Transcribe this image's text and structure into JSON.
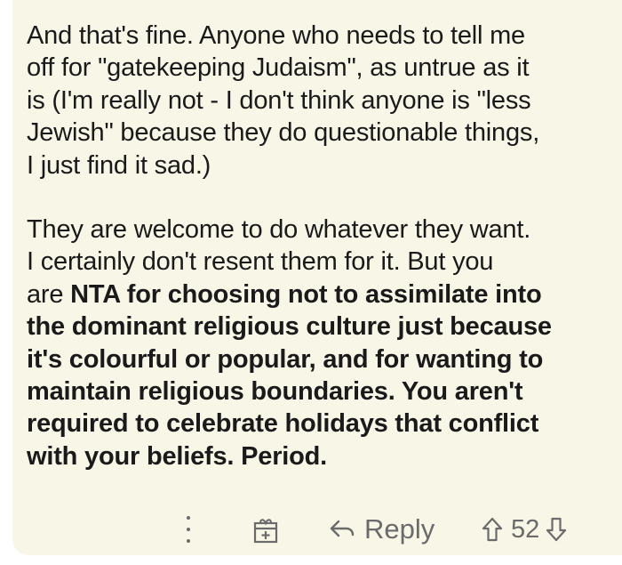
{
  "comment": {
    "paragraph1": [
      "And that's fine. Anyone who needs to tell me",
      "off for \"gatekeeping Judaism\", as untrue as it",
      "is (I'm really not - I don't think anyone is \"less",
      "Jewish\" because they do questionable things,",
      "I just find it sad.)"
    ],
    "paragraph2_normal": [
      "They are welcome to do whatever they want.",
      "I certainly don't resent them for it. But you",
      "are "
    ],
    "paragraph2_bold": [
      "NTA for choosing not to assimilate into",
      "the dominant religious culture just because",
      "it's colourful or popular, and for wanting to",
      "maintain religious boundaries. You aren't",
      "required to celebrate holidays that conflict",
      "with your beliefs. Period."
    ]
  },
  "actions": {
    "more_icon": "kebab-menu-icon",
    "award_icon": "gift-award-icon",
    "reply_icon": "reply-arrow-icon",
    "reply_label": "Reply",
    "upvote_icon": "upvote-arrow-icon",
    "downvote_icon": "downvote-arrow-icon",
    "score": "52"
  },
  "colors": {
    "card_background": "#f8f6e6",
    "text": "#1a1a1a",
    "icon_gray": "#6b6b6b"
  }
}
